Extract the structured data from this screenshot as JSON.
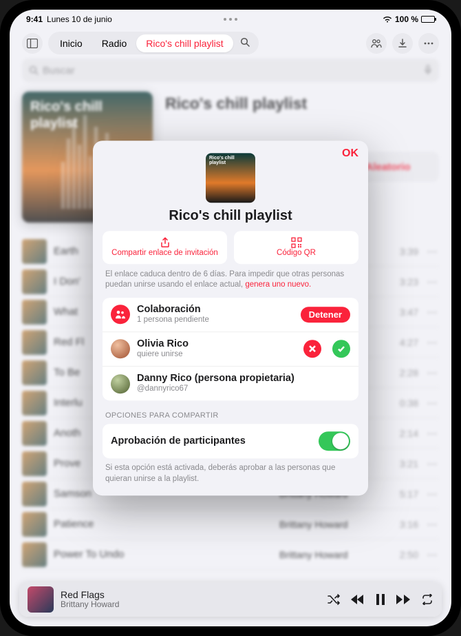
{
  "status": {
    "time": "9:41",
    "date": "Lunes 10 de junio",
    "battery": "100 %"
  },
  "nav": {
    "home": "Inicio",
    "radio": "Radio",
    "current": "Rico's chill playlist"
  },
  "search": {
    "placeholder": "Buscar"
  },
  "hero": {
    "cover_title": "Rico's chill playlist",
    "title": "Rico's chill playlist",
    "shuffle": "Aleatorio"
  },
  "tracks": [
    {
      "title": "Earth",
      "artist": "",
      "dur": "3:39"
    },
    {
      "title": "I Don'",
      "artist": "",
      "dur": "3:23"
    },
    {
      "title": "What",
      "artist": "",
      "dur": "3:47"
    },
    {
      "title": "Red Fl",
      "artist": "",
      "dur": "4:27"
    },
    {
      "title": "To Be",
      "artist": "",
      "dur": "2:28"
    },
    {
      "title": "Interlu",
      "artist": "",
      "dur": "0:38"
    },
    {
      "title": "Anoth",
      "artist": "",
      "dur": "2:14"
    },
    {
      "title": "Prove",
      "artist": "",
      "dur": "3:21"
    },
    {
      "title": "Samson",
      "artist": "Brittany Howard",
      "dur": "5:17"
    },
    {
      "title": "Patience",
      "artist": "Brittany Howard",
      "dur": "3:16"
    },
    {
      "title": "Power To Undo",
      "artist": "Brittany Howard",
      "dur": "2:50"
    }
  ],
  "now_playing": {
    "title": "Red Flags",
    "artist": "Brittany Howard"
  },
  "dialog": {
    "ok": "OK",
    "cover_title": "Rico's chill playlist",
    "title": "Rico's chill playlist",
    "share_link": "Compartir enlace de invitación",
    "qr_code": "Código QR",
    "expiry_pre": "El enlace caduca dentro de 6 días. Para impedir que otras personas puedan unirse usando el enlace actual, ",
    "expiry_link": "genera uno nuevo.",
    "collab_title": "Colaboración",
    "collab_sub": "1 persona pendiente",
    "stop": "Detener",
    "p1_name": "Olivia Rico",
    "p1_sub": "quiere unirse",
    "p2_name": "Danny Rico (persona propietaria)",
    "p2_sub": "@dannyrico67",
    "section": "OPCIONES PARA COMPARTIR",
    "approve": "Aprobación de participantes",
    "footnote": "Si esta opción está activada, deberás aprobar a las personas que quieran unirse a la playlist."
  }
}
